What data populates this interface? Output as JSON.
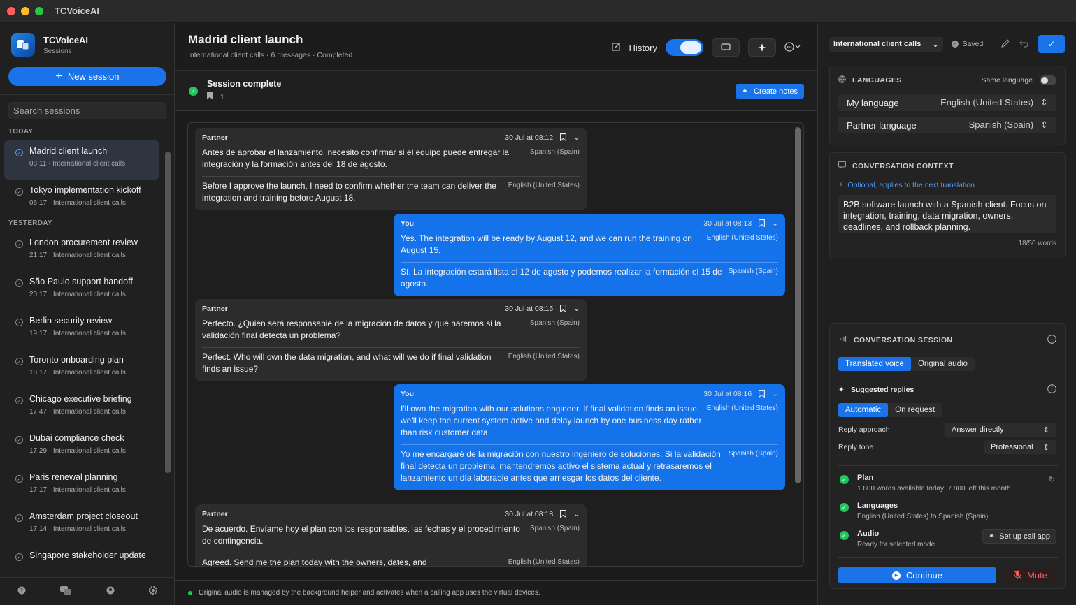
{
  "app": {
    "title": "TCVoiceAI"
  },
  "sidebar": {
    "brand_name": "TCVoiceAI",
    "brand_sub": "Sessions",
    "new_session": "New session",
    "search_placeholder": "Search sessions",
    "today_label": "TODAY",
    "yesterday_label": "YESTERDAY",
    "today": [
      {
        "title": "Madrid client launch",
        "time": "08:11",
        "category": "International client calls",
        "active": true
      },
      {
        "title": "Tokyo implementation kickoff",
        "time": "06:17",
        "category": "International client calls"
      }
    ],
    "yesterday": [
      {
        "title": "London procurement review",
        "time": "21:17",
        "category": "International client calls"
      },
      {
        "title": "São Paulo support handoff",
        "time": "20:17",
        "category": "International client calls"
      },
      {
        "title": "Berlin security review",
        "time": "19:17",
        "category": "International client calls"
      },
      {
        "title": "Toronto onboarding plan",
        "time": "18:17",
        "category": "International client calls"
      },
      {
        "title": "Chicago executive briefing",
        "time": "17:47",
        "category": "International client calls"
      },
      {
        "title": "Dubai compliance check",
        "time": "17:29",
        "category": "International client calls"
      },
      {
        "title": "Paris renewal planning",
        "time": "17:17",
        "category": "International client calls"
      },
      {
        "title": "Amsterdam project closeout",
        "time": "17:14",
        "category": "International client calls"
      },
      {
        "title": "Singapore stakeholder update",
        "time": "",
        "category": ""
      }
    ],
    "footer_icons": [
      "help-icon",
      "chat-icon",
      "account-icon",
      "settings-icon"
    ]
  },
  "main": {
    "title": "Madrid client launch",
    "subtitle": "International client calls · 6 messages · Completed",
    "history_label": "History",
    "status_title": "Session complete",
    "bookmark_count": "1",
    "create_notes": "Create notes",
    "footer_note": "Original audio is managed by the background helper and activates when a calling app uses the virtual devices.",
    "messages": [
      {
        "speaker": "Partner",
        "time": "30 Jul at 08:12",
        "original": "Antes de aprobar el lanzamiento, necesito confirmar si el equipo puede entregar la integración y la formación antes del 18 de agosto.",
        "original_lang": "Spanish (Spain)",
        "translation": "Before I approve the launch, I need to confirm whether the team can deliver the integration and training before August 18.",
        "translation_lang": "English (United States)"
      },
      {
        "speaker": "You",
        "time": "30 Jul at 08:13",
        "original": "Yes. The integration will be ready by August 12, and we can run the training on August 15.",
        "original_lang": "English (United States)",
        "translation": "Sí. La integración estará lista el 12 de agosto y podemos realizar la formación el 15 de agosto.",
        "translation_lang": "Spanish (Spain)"
      },
      {
        "speaker": "Partner",
        "time": "30 Jul at 08:15",
        "original": "Perfecto. ¿Quién será responsable de la migración de datos y qué haremos si la validación final detecta un problema?",
        "original_lang": "Spanish (Spain)",
        "translation": "Perfect. Who will own the data migration, and what will we do if final validation finds an issue?",
        "translation_lang": "English (United States)"
      },
      {
        "speaker": "You",
        "time": "30 Jul at 08:16",
        "original": "I'll own the migration with our solutions engineer. If final validation finds an issue, we'll keep the current system active and delay launch by one business day rather than risk customer data.",
        "original_lang": "English (United States)",
        "translation": "Yo me encargaré de la migración con nuestro ingeniero de soluciones. Si la validación final detecta un problema, mantendremos activo el sistema actual y retrasaremos el lanzamiento un día laborable antes que arriesgar los datos del cliente.",
        "translation_lang": "Spanish (Spain)"
      },
      {
        "speaker": "Partner",
        "time": "30 Jul at 08:18",
        "original": "De acuerdo. Envíame hoy el plan con los responsables, las fechas y el procedimiento de contingencia.",
        "original_lang": "Spanish (Spain)",
        "translation": "Agreed. Send me the plan today with the owners, dates, and",
        "translation_lang": "English (United States)"
      }
    ]
  },
  "right": {
    "profile": "International client calls",
    "saved": "Saved",
    "languages_label": "LANGUAGES",
    "same_language": "Same language",
    "my_language_label": "My language",
    "my_language": "English (United States)",
    "partner_language_label": "Partner language",
    "partner_language": "Spanish (Spain)",
    "context_label": "CONVERSATION CONTEXT",
    "context_hint": "Optional, applies to the next translation",
    "context_text": "B2B software launch with a Spanish client. Focus on integration, training, data migration, owners, deadlines, and rollback planning.",
    "words": "18/50 words",
    "session_label": "CONVERSATION SESSION",
    "audio_modes": [
      "Translated voice",
      "Original audio"
    ],
    "suggested_label": "Suggested replies",
    "reply_modes": [
      "Automatic",
      "On request"
    ],
    "reply_approach_label": "Reply approach",
    "reply_approach": "Answer directly",
    "reply_tone_label": "Reply tone",
    "reply_tone": "Professional",
    "plan_title": "Plan",
    "plan_sub": "1.800 words available today; 7.800 left this month",
    "languages_title": "Languages",
    "languages_sub": "English (United States) to Spanish (Spain)",
    "audio_title": "Audio",
    "audio_sub": "Ready for selected mode",
    "setup_btn": "Set up call app",
    "continue": "Continue",
    "mute": "Mute"
  }
}
